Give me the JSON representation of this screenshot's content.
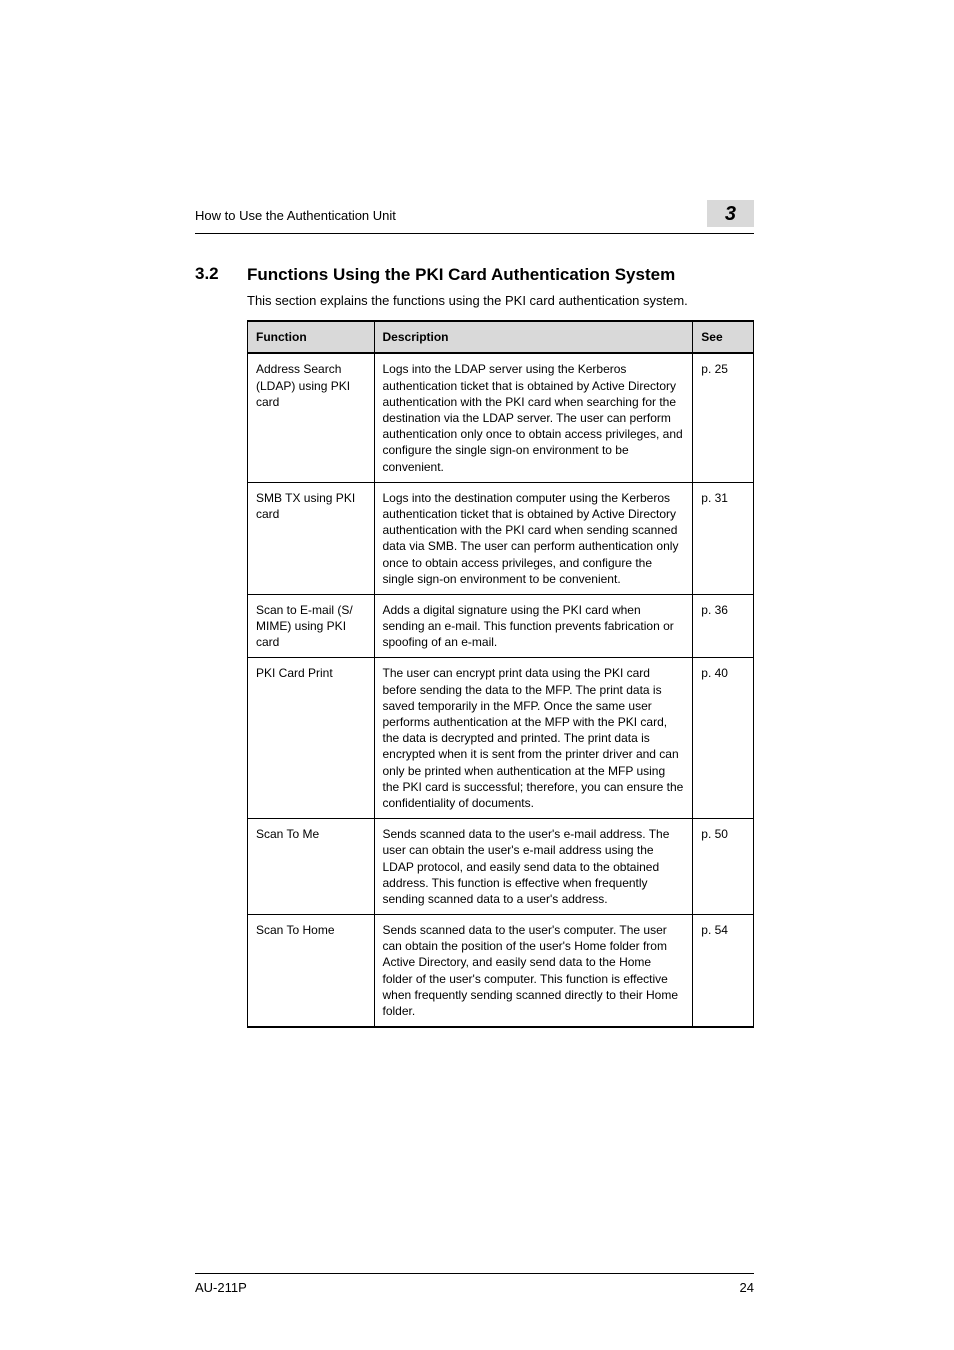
{
  "header": {
    "running_title": "How to Use the Authentication Unit",
    "chapter_number": "3"
  },
  "section": {
    "number": "3.2",
    "title": "Functions Using the PKI Card Authentication System",
    "intro": "This section explains the functions using the PKI card authentication system."
  },
  "table": {
    "headers": {
      "function": "Function",
      "description": "Description",
      "see": "See"
    },
    "rows": [
      {
        "function": "Address Search (LDAP) using PKI card",
        "description": "Logs into the LDAP server using the Kerberos authentication ticket that is obtained by Active Directory authentication with the PKI card when searching for the destination via the LDAP server. The user can perform authentication only once to obtain access privileges, and configure the single sign-on environment to be convenient.",
        "see": "p. 25"
      },
      {
        "function": "SMB TX using PKI card",
        "description": "Logs into the destination computer using the Kerberos authentication ticket that is obtained by Active Directory authentication with the PKI card when sending scanned data via SMB. The user can perform authentication only once to obtain access privileges, and configure the single sign-on environment to be convenient.",
        "see": "p. 31"
      },
      {
        "function": "Scan to E-mail (S/ MIME) using PKI card",
        "description": "Adds a digital signature using the PKI card when sending an e-mail. This function prevents fabrication or spoofing of an e-mail.",
        "see": "p. 36"
      },
      {
        "function": "PKI Card Print",
        "description": "The user can encrypt print data using the PKI card before sending the data to the MFP. The print data is saved temporarily in the MFP. Once the same user performs authentication at the MFP with the PKI card, the data is decrypted and printed. The print data is encrypted when it is sent from the printer driver and can only be printed when authentication at the MFP using the PKI card is successful; therefore, you can ensure the confidentiality of documents.",
        "see": "p. 40"
      },
      {
        "function": "Scan To Me",
        "description": "Sends scanned data to the user's e-mail address. The user can obtain the user's e-mail address using the LDAP protocol, and easily send data to the obtained address. This function is effective when frequently sending scanned data to a user's address.",
        "see": "p. 50"
      },
      {
        "function": "Scan To Home",
        "description": "Sends scanned data to the user's computer. The user can obtain the position of the user's Home folder from Active Directory, and easily send data to the Home folder of the user's computer. This function is effective when frequently sending scanned directly to their Home folder.",
        "see": "p. 54"
      }
    ]
  },
  "footer": {
    "model": "AU-211P",
    "page": "24"
  }
}
